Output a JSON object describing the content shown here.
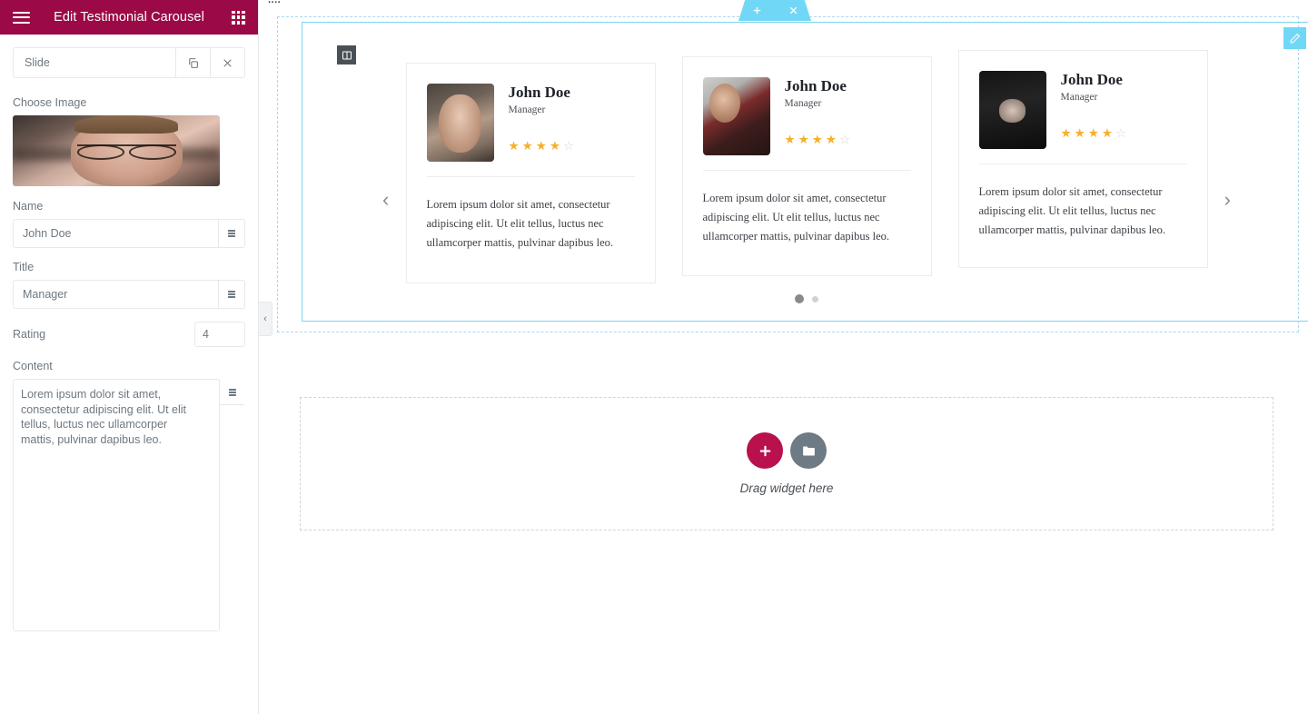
{
  "panel": {
    "header": {
      "title": "Edit Testimonial Carousel",
      "menu_icon": "hamburger-icon",
      "apps_icon": "grid-apps-icon",
      "bg_color": "#9b0a46"
    },
    "slide_bar": {
      "label": "Slide",
      "duplicate_icon": "copy-icon",
      "close_icon": "close-icon"
    },
    "fields": {
      "choose_image_label": "Choose Image",
      "name_label": "Name",
      "name_value": "John Doe",
      "title_label": "Title",
      "title_value": "Manager",
      "rating_label": "Rating",
      "rating_value": "4",
      "content_label": "Content",
      "content_value": "Lorem ipsum dolor sit amet, consectetur adipiscing elit. Ut elit tellus, luctus nec ullamcorper mattis, pulvinar dapibus leo.",
      "dynamic_icon": "dynamic-tags-icon"
    },
    "collapse_tab": "‹"
  },
  "canvas": {
    "cut_title": "....",
    "section_toolbar": {
      "add_icon": "plus-icon",
      "drag_icon": "drag-handle-icon",
      "delete_icon": "close-icon",
      "color": "#71d7f7"
    },
    "column_handle_icon": "column-layout-icon",
    "edit_badge_icon": "pencil-edit-icon",
    "carousel": {
      "prev_arrow": "‹",
      "next_arrow": "›",
      "dots": [
        {
          "state": "active"
        },
        {
          "state": "idle"
        }
      ],
      "slides": [
        {
          "name": "John Doe",
          "title": "Manager",
          "rating": 4,
          "max_rating": 5,
          "text": "Lorem ipsum dolor sit amet, consectetur adipiscing elit. Ut elit tellus, luctus nec ullamcorper mattis, pulvinar dapibus leo.",
          "avatar": "man-with-glasses-photo"
        },
        {
          "name": "John Doe",
          "title": "Manager",
          "rating": 4,
          "max_rating": 5,
          "text": "Lorem ipsum dolor sit amet, consectetur adipiscing elit. Ut elit tellus, luctus nec ullamcorper mattis, pulvinar dapibus leo.",
          "avatar": "man-in-plaid-shirt-photo"
        },
        {
          "name": "John Doe",
          "title": "Manager",
          "rating": 4,
          "max_rating": 5,
          "text": "Lorem ipsum dolor sit amet, consectetur adipiscing elit. Ut elit tellus, luctus nec ullamcorper mattis, pulvinar dapibus leo.",
          "avatar": "woman-in-black-hat-photo"
        }
      ]
    },
    "dropzone": {
      "label": "Drag widget here",
      "add_icon": "plus-icon",
      "add_color": "#b8114d",
      "folder_icon": "folder-icon",
      "folder_color": "#6e7a84"
    }
  }
}
